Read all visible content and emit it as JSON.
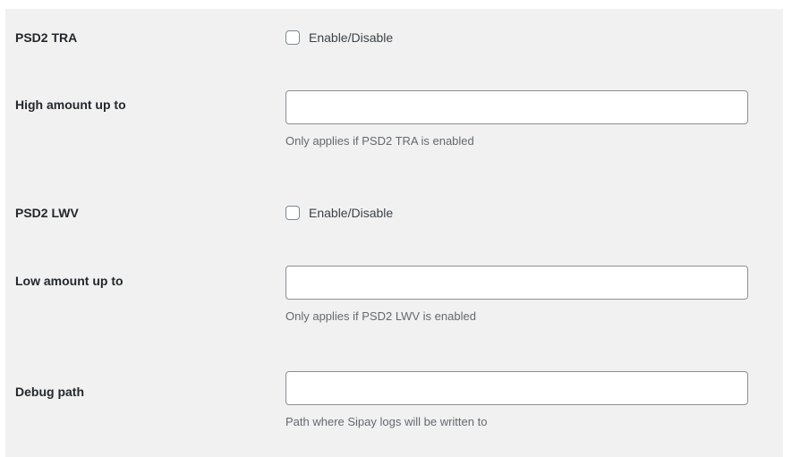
{
  "settings": {
    "psd2_tra": {
      "label": "PSD2 TRA",
      "checkbox_label": "Enable/Disable",
      "checked": false
    },
    "high_amount": {
      "label": "High amount up to",
      "value": "",
      "placeholder": "",
      "description": "Only applies if PSD2 TRA is enabled"
    },
    "psd2_lwv": {
      "label": "PSD2 LWV",
      "checkbox_label": "Enable/Disable",
      "checked": false
    },
    "low_amount": {
      "label": "Low amount up to",
      "value": "",
      "placeholder": "",
      "description": "Only applies if PSD2 LWV is enabled"
    },
    "debug_path": {
      "label": "Debug path",
      "value": "",
      "placeholder": "",
      "description": "Path where Sipay logs will be written to"
    }
  }
}
